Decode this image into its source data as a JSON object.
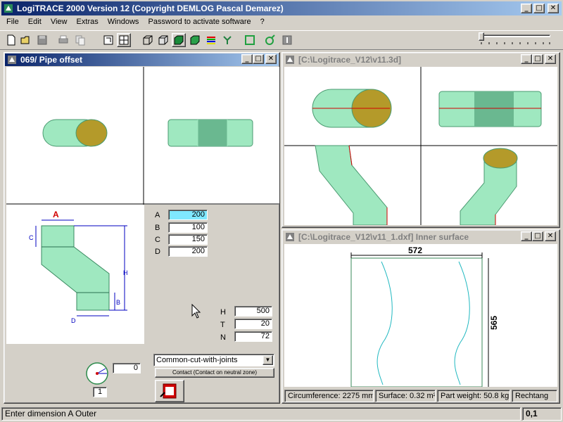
{
  "app": {
    "title": "LogiTRACE 2000  Version 12  (Copyright DEMLOG Pascal Demarez)",
    "menu": [
      "File",
      "Edit",
      "View",
      "Extras",
      "Windows",
      "Password to activate software",
      "?"
    ]
  },
  "window_controls": {
    "minimize": "_",
    "maximize": "□",
    "close": "✕"
  },
  "pipe_window": {
    "title": "069/ Pipe offset",
    "dimensions": [
      {
        "label": "A",
        "value": "200"
      },
      {
        "label": "B",
        "value": "100"
      },
      {
        "label": "C",
        "value": "150"
      },
      {
        "label": "D",
        "value": "200"
      }
    ],
    "params": [
      {
        "label": "H",
        "value": "500"
      },
      {
        "label": "T",
        "value": "20"
      },
      {
        "label": "N",
        "value": "72"
      }
    ],
    "diagram_labels": {
      "A": "A",
      "B": "B",
      "C": "C",
      "D": "D",
      "H": "H"
    },
    "angle_value": "0",
    "angle_index": "1",
    "cut_select": "Common-cut-with-joints",
    "contact_button": "Contact (Contact on neutral zone)"
  },
  "view3d_window": {
    "title": "[C:\\Logitrace_V12\\v11.3d]"
  },
  "dxf_window": {
    "title": "[C:\\Logitrace_V12\\v11_1.dxf]  Inner surface",
    "width_label": "572",
    "height_label": "565",
    "status": {
      "circumference": "Circumference: 2275 mm",
      "surface": "Surface: 0.32 m²",
      "weight": "Part weight: 50.8 kg",
      "shape": "Rechtang"
    }
  },
  "statusbar": {
    "message": "Enter dimension A Outer",
    "coords": "0,1"
  },
  "colors": {
    "title_active": "#0a246a",
    "pipe_green": "#9fe8c0",
    "pipe_gold": "#b49a2a",
    "dim_blue": "#0000c0",
    "dim_red": "#d00000"
  }
}
